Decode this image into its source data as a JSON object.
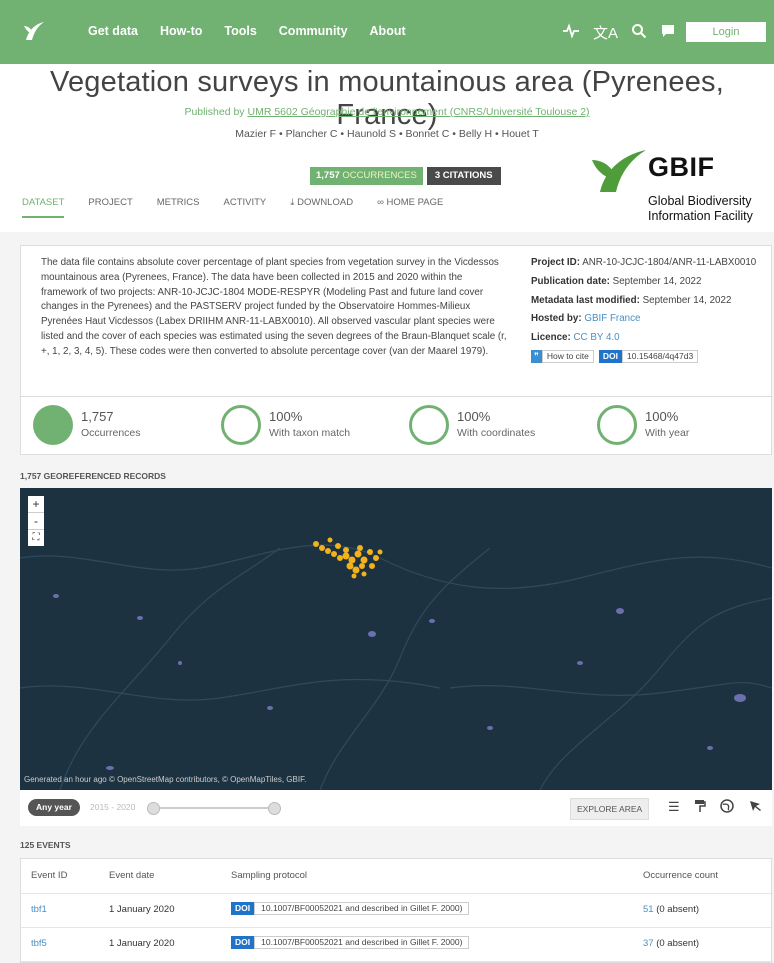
{
  "nav": {
    "items": [
      "Get data",
      "How-to",
      "Tools",
      "Community",
      "About"
    ],
    "icons": [
      "activity-icon",
      "translate-icon",
      "search-icon",
      "chat-icon"
    ],
    "login": "Login"
  },
  "dataset": {
    "title": "Vegetation surveys in mountainous area (Pyrenees, France)",
    "published_by_prefix": "Published by ",
    "publisher": "UMR 5602 Géographie de l'environnement (CNRS/Université Toulouse 2)",
    "authors": "Mazier F • Plancher C • Haunold S • Bonnet C • Belly H • Houet T",
    "occurrences_badge_count": "1,757",
    "occurrences_badge_label": "OCCURRENCES",
    "citations_badge": "3 CITATIONS"
  },
  "tabs": [
    "DATASET",
    "PROJECT",
    "METRICS",
    "ACTIVITY",
    "⤓ DOWNLOAD",
    "∞ HOME PAGE"
  ],
  "gbif": {
    "name": "GBIF",
    "line1": "Global Biodiversity",
    "line2": "Information Facility"
  },
  "description": "The data file contains absolute cover percentage of plant species from vegetation survey in the Vicdessos mountainous area (Pyrenees, France). The data have been collected in 2015 and 2020 within the framework of two projects: ANR-10-JCJC-1804 MODE-RESPYR (Modeling Past and future land cover changes in the Pyrenees) and the PASTSERV project funded by the Observatoire Hommes-Milieux Pyrenées Haut Vicdessos (Labex DRIIHM ANR-11-LABX0010). All observed vascular plant species were listed and the cover of each species was estimated using the seven degrees of the Braun-Blanquet scale (r, +, 1, 2, 3, 4, 5). These codes were then converted to absolute percentage cover (van der Maarel 1979).",
  "meta": {
    "project_label": "Project ID:",
    "project_value": "ANR-10-JCJC-1804/ANR-11-LABX0010",
    "pubdate_label": "Publication date:",
    "pubdate_value": "September 14, 2022",
    "modified_label": "Metadata last modified:",
    "modified_value": "September 14, 2022",
    "hosted_label": "Hosted by:",
    "hosted_value": "GBIF France",
    "licence_label": "Licence:",
    "licence_value": "CC BY 4.0",
    "cite_icon": "❞",
    "how_to_cite": "How to cite",
    "doi_label": "DOI",
    "doi_value": "10.15468/4q47d3"
  },
  "stats": [
    {
      "value": "1,757",
      "label": "Occurrences",
      "fill": 1
    },
    {
      "value": "100%",
      "label": "With taxon match",
      "fill": 1
    },
    {
      "value": "100%",
      "label": "With coordinates",
      "fill": 1
    },
    {
      "value": "100%",
      "label": "With year",
      "fill": 1
    }
  ],
  "map": {
    "header": "1,757 GEOREFERENCED RECORDS",
    "zoom_in": "+",
    "zoom_out": "-",
    "fullscreen": "⛶",
    "attribution": "Generated an hour ago © OpenStreetMap contributors, © OpenMapTiles, GBIF.",
    "any_year": "Any year",
    "range": "2015 - 2020",
    "explore": "EXPLORE AREA",
    "tool_icons": [
      "filter-icon",
      "paint-roller-icon",
      "globe-icon",
      "cursor-icon"
    ]
  },
  "events": {
    "header": "125 EVENTS",
    "columns": [
      "Event ID",
      "Event date",
      "Sampling protocol",
      "Occurrence count"
    ],
    "rows": [
      {
        "id": "tbf1",
        "date": "1 January 2020",
        "doi": "DOI",
        "protocol": "10.1007/BF00052021 and described in Gillet F. 2000)",
        "count": "51",
        "absent": "(0 absent)"
      },
      {
        "id": "tbf5",
        "date": "1 January 2020",
        "doi": "DOI",
        "protocol": "10.1007/BF00052021 and described in Gillet F. 2000)",
        "count": "37",
        "absent": "(0 absent)"
      }
    ]
  },
  "colors": {
    "brand_green": "#71b171",
    "map_bg": "#1d3241",
    "doi_blue": "#1f74c9",
    "point_orange": "#f2b21b"
  }
}
